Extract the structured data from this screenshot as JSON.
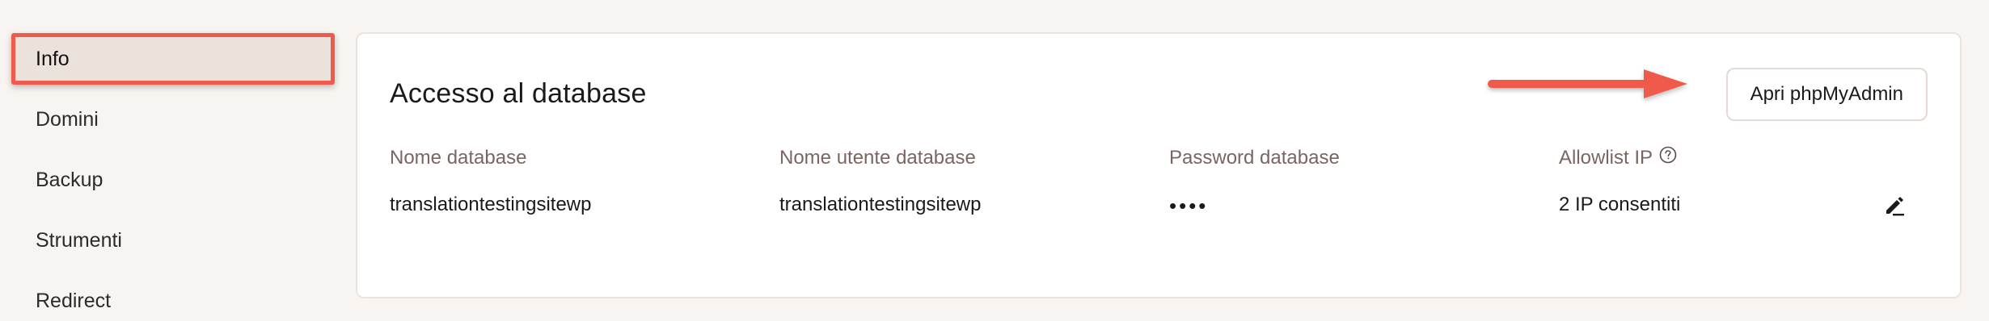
{
  "sidebar": {
    "items": [
      {
        "label": "Info",
        "active": true
      },
      {
        "label": "Domini",
        "active": false
      },
      {
        "label": "Backup",
        "active": false
      },
      {
        "label": "Strumenti",
        "active": false
      },
      {
        "label": "Redirect",
        "active": false
      }
    ]
  },
  "card": {
    "title": "Accesso al database",
    "open_button_label": "Apri phpMyAdmin",
    "fields": [
      {
        "label": "Nome database",
        "value": "translationtestingsitewp"
      },
      {
        "label": "Nome utente database",
        "value": "translationtestingsitewp"
      },
      {
        "label": "Password database",
        "value": "••••"
      },
      {
        "label": "Allowlist IP",
        "value": "2 IP consentiti"
      }
    ]
  },
  "icons": {
    "help": "help-circle-icon",
    "edit": "pencil-edit-icon",
    "arrow": "arrow-right-annotation"
  },
  "colors": {
    "accent_red": "#ef5a4c",
    "active_bg": "#ebe2db",
    "label_color": "#7a6561",
    "page_bg": "#f8f4f1"
  }
}
